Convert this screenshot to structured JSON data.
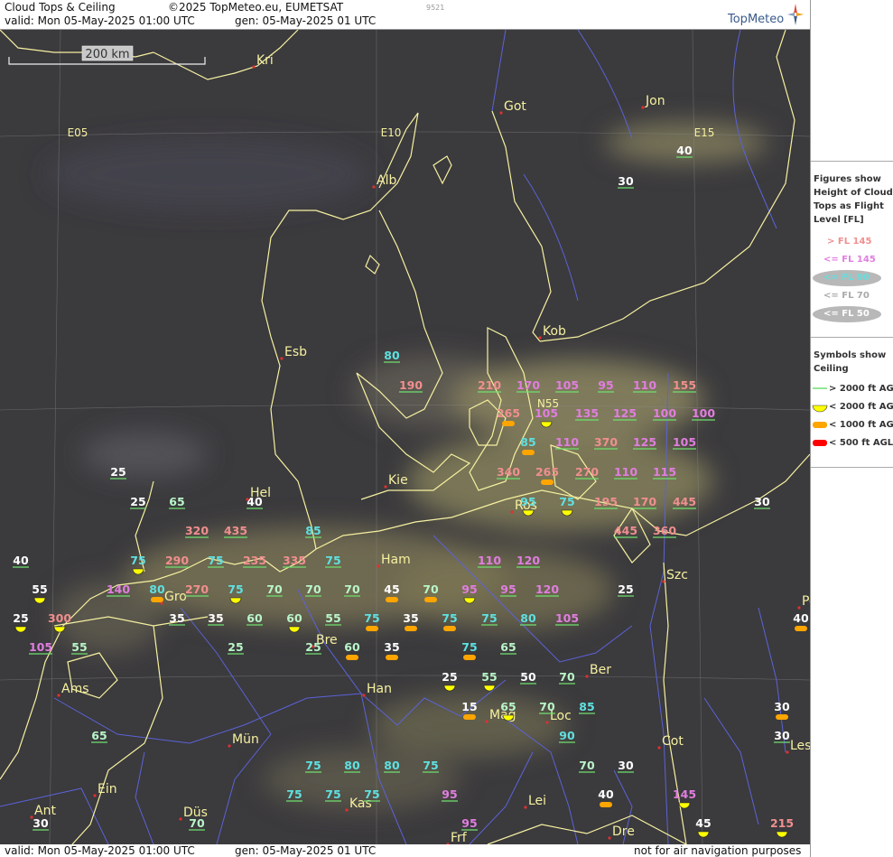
{
  "header": {
    "title": "Cloud Tops & Ceiling",
    "copyright": "©2025 TopMeteo.eu, EUMETSAT",
    "code": "9521",
    "valid": "valid:  Mon  05-May-2025  01:00 UTC",
    "gen": "gen: 05-May-2025 01 UTC",
    "logo": "TopMeteo"
  },
  "footer": {
    "valid": "valid:  Mon  05-May-2025  01:00 UTC",
    "gen": "gen: 05-May-2025 01 UTC",
    "disclaimer": "not for air navigation purposes"
  },
  "scale_bar": {
    "label": "200 km"
  },
  "legend": {
    "figures_heading": "Figures show Height of Cloud Tops as Flight Level  [FL]",
    "figures": [
      {
        "label": "> FL 145",
        "color": "#f08f8f"
      },
      {
        "label": "<= FL 145",
        "color": "#e07ee0"
      },
      {
        "label": "<= FL 90",
        "color": "#5fe0e0"
      },
      {
        "label": "<= FL 70",
        "color": "#bbbbbb"
      },
      {
        "label": "<= FL 50",
        "color": "#ffffff"
      }
    ],
    "symbols_heading": "Symbols show Ceiling",
    "symbols": [
      {
        "label": "> 2000 ft AGL",
        "color": "#6fe06f"
      },
      {
        "label": "< 2000 ft AGL",
        "color": "#ffff00"
      },
      {
        "label": "< 1000 ft AGL",
        "color": "#ffa500"
      },
      {
        "label": "< 500 ft AGL",
        "color": "#ff0000"
      }
    ]
  },
  "colors": {
    "fl_gt145": "#f08f8f",
    "fl_le145": "#e07ee0",
    "fl_le90": "#5fe0e0",
    "fl_le70": "#b9f5c8",
    "fl_le50": "#ffffff",
    "coast": "#f6f1a0",
    "river": "#5b63d8"
  },
  "grid_labels": [
    "E05",
    "E10",
    "E15",
    "N55"
  ],
  "cities": [
    "Kri",
    "Got",
    "Jon",
    "Alb",
    "Kob",
    "Esb",
    "Kie",
    "Hel",
    "Ros",
    "Ham",
    "Szc",
    "Gro",
    "Bre",
    "Ams",
    "Han",
    "Ber",
    "Mag",
    "Loc",
    "Mün",
    "Cot",
    "Les",
    "Ein",
    "Kas",
    "Lei",
    "Dre",
    "Ant",
    "Düs",
    "Frf",
    "Po"
  ],
  "figures": [
    {
      "v": "40",
      "c": "w"
    },
    {
      "v": "30",
      "c": "w"
    },
    {
      "v": "80",
      "c": "c"
    },
    {
      "v": "190",
      "c": "r"
    },
    {
      "v": "210",
      "c": "r"
    },
    {
      "v": "170",
      "c": "m"
    },
    {
      "v": "105",
      "c": "m"
    },
    {
      "v": "95",
      "c": "m"
    },
    {
      "v": "110",
      "c": "m"
    },
    {
      "v": "155",
      "c": "r"
    },
    {
      "v": "265",
      "c": "r",
      "s": "o"
    },
    {
      "v": "105",
      "c": "m",
      "s": "y"
    },
    {
      "v": "135",
      "c": "m"
    },
    {
      "v": "125",
      "c": "m"
    },
    {
      "v": "100",
      "c": "m"
    },
    {
      "v": "100",
      "c": "m"
    },
    {
      "v": "85",
      "c": "c",
      "s": "o"
    },
    {
      "v": "110",
      "c": "m"
    },
    {
      "v": "370",
      "c": "r"
    },
    {
      "v": "125",
      "c": "m"
    },
    {
      "v": "105",
      "c": "m"
    },
    {
      "v": "340",
      "c": "r"
    },
    {
      "v": "265",
      "c": "r",
      "s": "o"
    },
    {
      "v": "270",
      "c": "r"
    },
    {
      "v": "110",
      "c": "m"
    },
    {
      "v": "115",
      "c": "m"
    },
    {
      "v": "25",
      "c": "w"
    },
    {
      "v": "25",
      "c": "w"
    },
    {
      "v": "65",
      "c": "g"
    },
    {
      "v": "40",
      "c": "w"
    },
    {
      "v": "95",
      "c": "c",
      "s": "y"
    },
    {
      "v": "75",
      "c": "c",
      "s": "y"
    },
    {
      "v": "195",
      "c": "r"
    },
    {
      "v": "170",
      "c": "r"
    },
    {
      "v": "445",
      "c": "r"
    },
    {
      "v": "30",
      "c": "w"
    },
    {
      "v": "320",
      "c": "r"
    },
    {
      "v": "435",
      "c": "r"
    },
    {
      "v": "85",
      "c": "c"
    },
    {
      "v": "445",
      "c": "r"
    },
    {
      "v": "360",
      "c": "r"
    },
    {
      "v": "40",
      "c": "w"
    },
    {
      "v": "75",
      "c": "c",
      "s": "y"
    },
    {
      "v": "290",
      "c": "r"
    },
    {
      "v": "75",
      "c": "c"
    },
    {
      "v": "235",
      "c": "r"
    },
    {
      "v": "335",
      "c": "r"
    },
    {
      "v": "75",
      "c": "c"
    },
    {
      "v": "110",
      "c": "m"
    },
    {
      "v": "120",
      "c": "m"
    },
    {
      "v": "55",
      "c": "w",
      "s": "y"
    },
    {
      "v": "140",
      "c": "m"
    },
    {
      "v": "80",
      "c": "c",
      "s": "o"
    },
    {
      "v": "270",
      "c": "r"
    },
    {
      "v": "75",
      "c": "c",
      "s": "y"
    },
    {
      "v": "70",
      "c": "g"
    },
    {
      "v": "70",
      "c": "g"
    },
    {
      "v": "70",
      "c": "g"
    },
    {
      "v": "45",
      "c": "w",
      "s": "o"
    },
    {
      "v": "70",
      "c": "g",
      "s": "o"
    },
    {
      "v": "95",
      "c": "m",
      "s": "y"
    },
    {
      "v": "95",
      "c": "m"
    },
    {
      "v": "120",
      "c": "m"
    },
    {
      "v": "25",
      "c": "w"
    },
    {
      "v": "25",
      "c": "w",
      "s": "y"
    },
    {
      "v": "300",
      "c": "r",
      "s": "y"
    },
    {
      "v": "35",
      "c": "w"
    },
    {
      "v": "35",
      "c": "w"
    },
    {
      "v": "60",
      "c": "g"
    },
    {
      "v": "60",
      "c": "g",
      "s": "y"
    },
    {
      "v": "55",
      "c": "g"
    },
    {
      "v": "75",
      "c": "c",
      "s": "o"
    },
    {
      "v": "35",
      "c": "w",
      "s": "o"
    },
    {
      "v": "75",
      "c": "c",
      "s": "o"
    },
    {
      "v": "75",
      "c": "c"
    },
    {
      "v": "80",
      "c": "c"
    },
    {
      "v": "105",
      "c": "m"
    },
    {
      "v": "40",
      "c": "w",
      "s": "o"
    },
    {
      "v": "105",
      "c": "m"
    },
    {
      "v": "55",
      "c": "g"
    },
    {
      "v": "25",
      "c": "g"
    },
    {
      "v": "25",
      "c": "g"
    },
    {
      "v": "60",
      "c": "g",
      "s": "o"
    },
    {
      "v": "35",
      "c": "w",
      "s": "o"
    },
    {
      "v": "75",
      "c": "c",
      "s": "o"
    },
    {
      "v": "65",
      "c": "g"
    },
    {
      "v": "25",
      "c": "w",
      "s": "y"
    },
    {
      "v": "55",
      "c": "g",
      "s": "y"
    },
    {
      "v": "50",
      "c": "w"
    },
    {
      "v": "70",
      "c": "g"
    },
    {
      "v": "15",
      "c": "w",
      "s": "o"
    },
    {
      "v": "65",
      "c": "g",
      "s": "y"
    },
    {
      "v": "70",
      "c": "g"
    },
    {
      "v": "85",
      "c": "c"
    },
    {
      "v": "30",
      "c": "w",
      "s": "o"
    },
    {
      "v": "65",
      "c": "g"
    },
    {
      "v": "90",
      "c": "c"
    },
    {
      "v": "30",
      "c": "w"
    },
    {
      "v": "75",
      "c": "c"
    },
    {
      "v": "80",
      "c": "c"
    },
    {
      "v": "80",
      "c": "c"
    },
    {
      "v": "75",
      "c": "c"
    },
    {
      "v": "70",
      "c": "g"
    },
    {
      "v": "30",
      "c": "w"
    },
    {
      "v": "75",
      "c": "c"
    },
    {
      "v": "75",
      "c": "c"
    },
    {
      "v": "75",
      "c": "c"
    },
    {
      "v": "95",
      "c": "m"
    },
    {
      "v": "40",
      "c": "w",
      "s": "o"
    },
    {
      "v": "145",
      "c": "m",
      "s": "y"
    },
    {
      "v": "30",
      "c": "w"
    },
    {
      "v": "70",
      "c": "g"
    },
    {
      "v": "95",
      "c": "m"
    },
    {
      "v": "45",
      "c": "w",
      "s": "y"
    },
    {
      "v": "215",
      "c": "r",
      "s": "y"
    },
    {
      "v": "30",
      "c": "w"
    }
  ]
}
